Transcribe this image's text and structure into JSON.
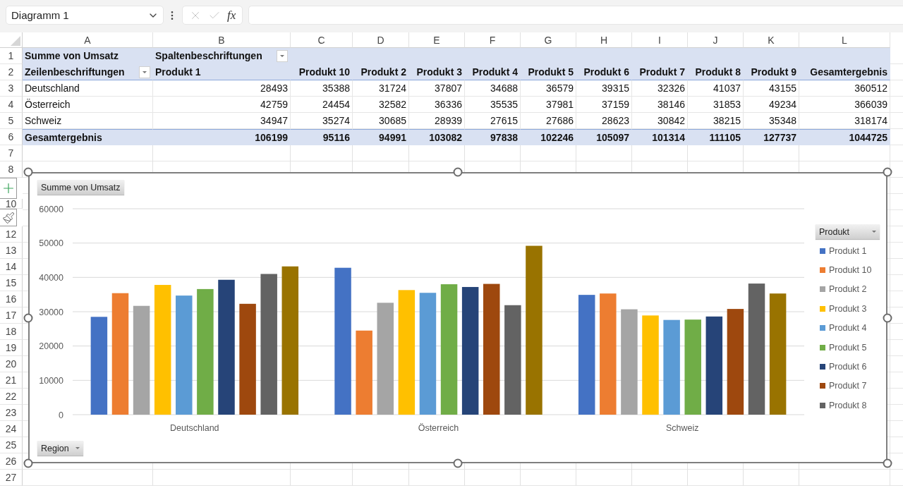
{
  "name_box": {
    "value": "Diagramm 1"
  },
  "formula_bar": {
    "fx_label": "fx"
  },
  "columns": [
    "A",
    "B",
    "C",
    "D",
    "E",
    "F",
    "G",
    "H",
    "I",
    "J",
    "K",
    "L"
  ],
  "row_numbers": [
    "1",
    "2",
    "3",
    "4",
    "5",
    "6",
    "7",
    "8",
    "10",
    "12",
    "13",
    "14",
    "15",
    "16",
    "17",
    "18",
    "19",
    "20",
    "21",
    "22",
    "23",
    "24",
    "25",
    "26",
    "27"
  ],
  "pivot": {
    "title": "Summe von Umsatz",
    "column_labels": "Spaltenbeschriftungen",
    "row_labels": "Zeilenbeschriftungen",
    "columns": [
      "Produkt 1",
      "Produkt 10",
      "Produkt 2",
      "Produkt 3",
      "Produkt 4",
      "Produkt 5",
      "Produkt 6",
      "Produkt 7",
      "Produkt 8",
      "Produkt 9",
      "Gesamtergebnis"
    ],
    "rows": [
      {
        "label": "Deutschland",
        "values": [
          "28493",
          "35388",
          "31724",
          "37807",
          "34688",
          "36579",
          "39315",
          "32326",
          "41037",
          "43155",
          "360512"
        ]
      },
      {
        "label": "Österreich",
        "values": [
          "42759",
          "24454",
          "32582",
          "36336",
          "35535",
          "37981",
          "37159",
          "38146",
          "31853",
          "49234",
          "366039"
        ]
      },
      {
        "label": "Schweiz",
        "values": [
          "34947",
          "35274",
          "30685",
          "28939",
          "27615",
          "27686",
          "28623",
          "30842",
          "38215",
          "35348",
          "318174"
        ]
      }
    ],
    "total": {
      "label": "Gesamtergebnis",
      "values": [
        "106199",
        "95116",
        "94991",
        "103082",
        "97838",
        "102246",
        "105097",
        "101314",
        "111105",
        "127737",
        "1044725"
      ]
    }
  },
  "chart": {
    "selected": true,
    "value_field_button": "Summe von Umsatz",
    "axis_field_button": "Region",
    "legend_field_button": "Produkt",
    "chart_data": {
      "type": "bar",
      "categories": [
        "Deutschland",
        "Österreich",
        "Schweiz"
      ],
      "ylim": [
        0,
        60000
      ],
      "yticks": [
        0,
        10000,
        20000,
        30000,
        40000,
        50000,
        60000
      ],
      "grid": true,
      "legend": true,
      "series": [
        {
          "name": "Produkt 1",
          "color": "#4472c4",
          "values": [
            28500,
            42800,
            34900
          ]
        },
        {
          "name": "Produkt 10",
          "color": "#ed7d31",
          "values": [
            35400,
            24500,
            35300
          ]
        },
        {
          "name": "Produkt 2",
          "color": "#a5a5a5",
          "values": [
            31700,
            32600,
            30700
          ]
        },
        {
          "name": "Produkt 3",
          "color": "#ffc000",
          "values": [
            37800,
            36300,
            28900
          ]
        },
        {
          "name": "Produkt 4",
          "color": "#5b9bd5",
          "values": [
            34700,
            35500,
            27600
          ]
        },
        {
          "name": "Produkt 5",
          "color": "#70ad47",
          "values": [
            36600,
            38000,
            27700
          ]
        },
        {
          "name": "Produkt 6",
          "color": "#264478",
          "values": [
            39300,
            37200,
            28600
          ]
        },
        {
          "name": "Produkt 7",
          "color": "#9e480e",
          "values": [
            32300,
            38100,
            30800
          ]
        },
        {
          "name": "Produkt 8",
          "color": "#636363",
          "values": [
            41000,
            31900,
            38200
          ]
        },
        {
          "color": "#997300",
          "values": [
            43200,
            49200,
            35300
          ]
        }
      ]
    }
  }
}
